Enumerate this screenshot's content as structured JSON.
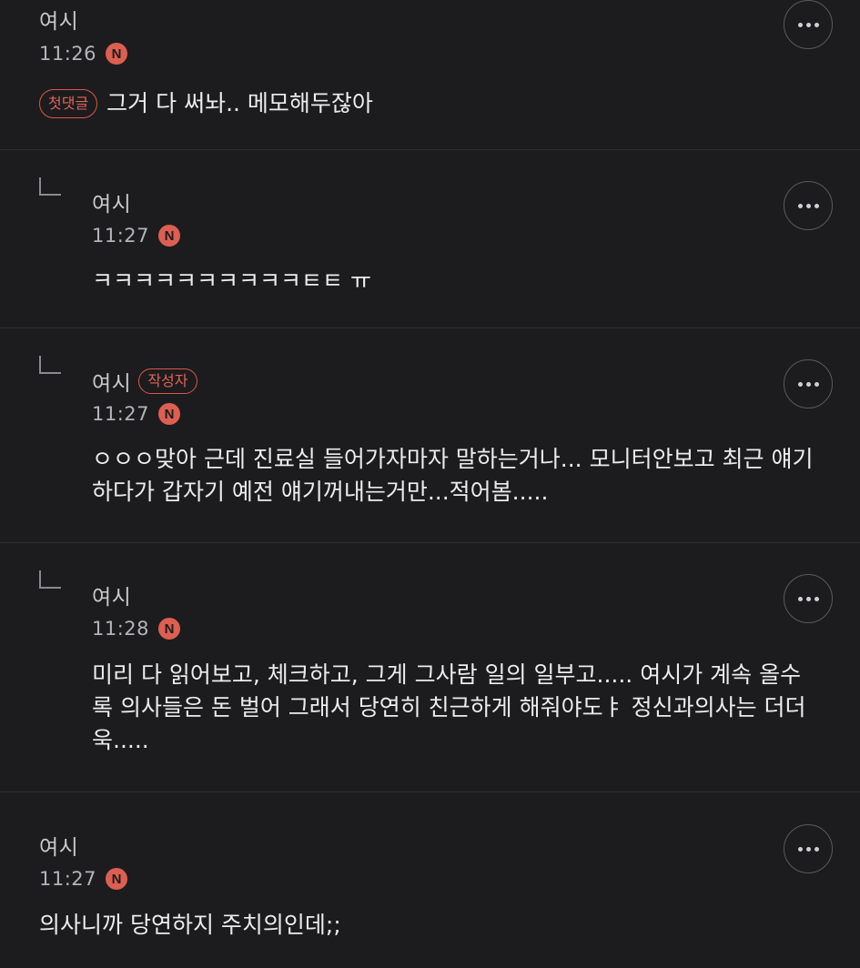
{
  "comments": [
    {
      "nickname": "여시",
      "time": "11:26",
      "new_badge": "N",
      "first_comment_badge": "첫댓글",
      "text": "그거 다 써놔.. 메모해두잖아"
    },
    {
      "nickname": "여시",
      "time": "11:27",
      "new_badge": "N",
      "text": "ㅋㅋㅋㅋㅋㅋㅋㅋㅋㅋㅌㅌ ㅠ"
    },
    {
      "nickname": "여시",
      "author_badge": "작성자",
      "time": "11:27",
      "new_badge": "N",
      "text": "ㅇㅇㅇ맞아 근데 진료실 들어가자마자 말하는거나... 모니터안보고 최근 얘기하다가 갑자기 예전 얘기꺼내는거만...적어봄....."
    },
    {
      "nickname": "여시",
      "time": "11:28",
      "new_badge": "N",
      "text": "미리 다 읽어보고, 체크하고, 그게 그사람 일의 일부고..... 여시가 계속 올수록 의사들은 돈 벌어 그래서 당연히 친근하게 해줘야도ㅑ 정신과의사는 더더욱....."
    },
    {
      "nickname": "여시",
      "time": "11:27",
      "new_badge": "N",
      "text": "의사니까 당연하지 주치의인데;;"
    }
  ],
  "more_icon": "more-horizontal-icon",
  "colors": {
    "background": "#1c1c1e",
    "accent": "#dc5f52",
    "divider": "#2f2f31"
  }
}
